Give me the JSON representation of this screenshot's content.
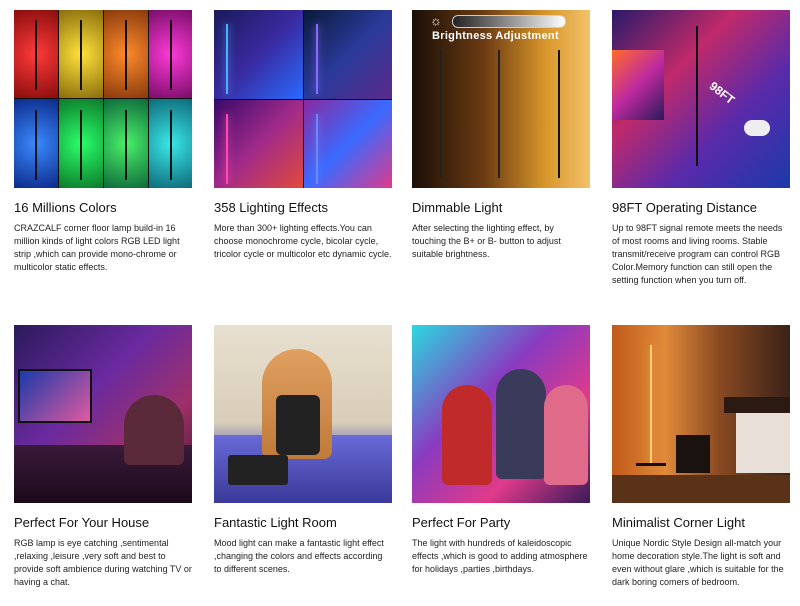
{
  "features": [
    {
      "title": "16 Millions Colors",
      "description": "CRAZCALF corner floor lamp build-in 16 million kinds of light colors RGB LED light strip ,which can provide mono-chrome or multicolor static effects."
    },
    {
      "title": "358 Lighting Effects",
      "description": "More than 300+ lighting effects.You can choose monochrome cycle, bicolar cycle, tricolor cycle or multicolor etc dynamic cycle."
    },
    {
      "title": "Dimmable Light",
      "description": "After selecting the lighting effect, by touching the B+ or B- button to adjust suitable brightness.",
      "overlay_label": "Brightness Adjustment"
    },
    {
      "title": "98FT Operating Distance",
      "description": "Up to 98FT signal remote meets the needs of most rooms and living rooms. Stable transmit/receive program can control RGB Color.Memory function can still open the setting function when you turn off.",
      "overlay_label": "98FT"
    },
    {
      "title": "Perfect For Your House",
      "description": "RGB lamp is eye catching ,sentimental ,relaxing ,leisure ,very soft and best to provide soft ambience during watching TV or having a chat."
    },
    {
      "title": "Fantastic Light Room",
      "description": "Mood light can make a fantastic light effect ,changing the colors and effects according to different scenes."
    },
    {
      "title": "Perfect For Party",
      "description": "The light with hundreds of kaleidoscopic effects ,which is good to adding atmosphere for holidays ,parties ,birthdays."
    },
    {
      "title": "Minimalist Corner Light",
      "description": "Unique Nordic Style Design all-match your home decoration style.The light is soft and even without glare ,which is suitable for the dark boring comers of bedroom."
    }
  ]
}
